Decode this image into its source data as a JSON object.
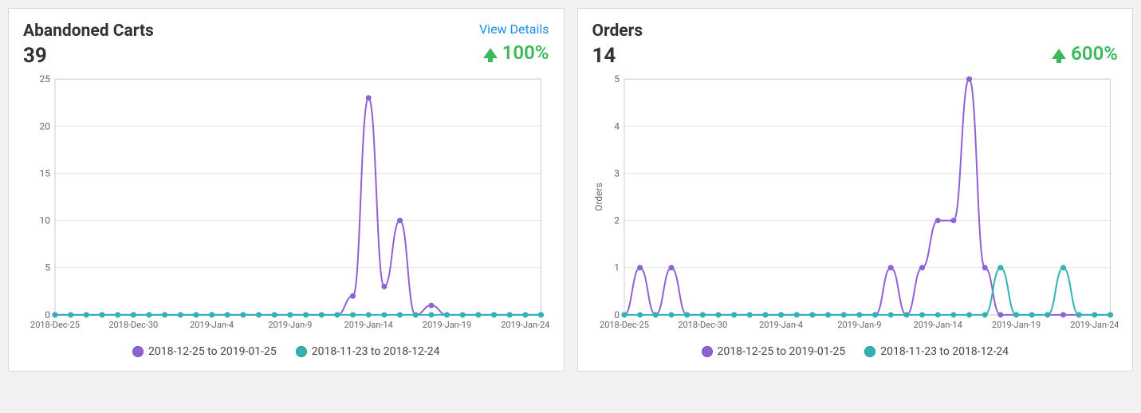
{
  "cards": {
    "abandoned": {
      "title": "Abandoned Carts",
      "value": "39",
      "details_label": "View Details",
      "change": "100%"
    },
    "orders": {
      "title": "Orders",
      "value": "14",
      "change": "600%",
      "yaxis_label": "Orders"
    }
  },
  "legend": {
    "series_a": "2018-12-25 to 2019-01-25",
    "series_b": "2018-11-23 to 2018-12-24"
  },
  "x_ticks": [
    "2018-Dec-25",
    "2018-Dec-30",
    "2019-Jan-4",
    "2019-Jan-9",
    "2019-Jan-14",
    "2019-Jan-19",
    "2019-Jan-24"
  ],
  "colors": {
    "purple": "#8e62d4",
    "teal": "#32b2b2",
    "up": "#3cb95d"
  },
  "chart_data": [
    {
      "type": "line",
      "title": "Abandoned Carts",
      "ylim": [
        0,
        25
      ],
      "yticks": [
        0,
        5,
        10,
        15,
        20,
        25
      ],
      "x": [
        "2018-Dec-25",
        "2018-Dec-26",
        "2018-Dec-27",
        "2018-Dec-28",
        "2018-Dec-29",
        "2018-Dec-30",
        "2018-Dec-31",
        "2019-Jan-1",
        "2019-Jan-2",
        "2019-Jan-3",
        "2019-Jan-4",
        "2019-Jan-5",
        "2019-Jan-6",
        "2019-Jan-7",
        "2019-Jan-8",
        "2019-Jan-9",
        "2019-Jan-10",
        "2019-Jan-11",
        "2019-Jan-12",
        "2019-Jan-13",
        "2019-Jan-14",
        "2019-Jan-15",
        "2019-Jan-16",
        "2019-Jan-17",
        "2019-Jan-18",
        "2019-Jan-19",
        "2019-Jan-20",
        "2019-Jan-21",
        "2019-Jan-22",
        "2019-Jan-23",
        "2019-Jan-24",
        "2019-Jan-25"
      ],
      "series": [
        {
          "name": "2018-12-25 to 2019-01-25",
          "values": [
            0,
            0,
            0,
            0,
            0,
            0,
            0,
            0,
            0,
            0,
            0,
            0,
            0,
            0,
            0,
            0,
            0,
            0,
            0,
            2,
            23,
            3,
            10,
            0,
            1,
            0,
            0,
            0,
            0,
            0,
            0,
            0
          ]
        },
        {
          "name": "2018-11-23 to 2018-12-24",
          "values": [
            0,
            0,
            0,
            0,
            0,
            0,
            0,
            0,
            0,
            0,
            0,
            0,
            0,
            0,
            0,
            0,
            0,
            0,
            0,
            0,
            0,
            0,
            0,
            0,
            0,
            0,
            0,
            0,
            0,
            0,
            0,
            0
          ]
        }
      ]
    },
    {
      "type": "line",
      "title": "Orders",
      "ylabel": "Orders",
      "ylim": [
        0,
        5
      ],
      "yticks": [
        0,
        1,
        2,
        3,
        4,
        5
      ],
      "x": [
        "2018-Dec-25",
        "2018-Dec-26",
        "2018-Dec-27",
        "2018-Dec-28",
        "2018-Dec-29",
        "2018-Dec-30",
        "2018-Dec-31",
        "2019-Jan-1",
        "2019-Jan-2",
        "2019-Jan-3",
        "2019-Jan-4",
        "2019-Jan-5",
        "2019-Jan-6",
        "2019-Jan-7",
        "2019-Jan-8",
        "2019-Jan-9",
        "2019-Jan-10",
        "2019-Jan-11",
        "2019-Jan-12",
        "2019-Jan-13",
        "2019-Jan-14",
        "2019-Jan-15",
        "2019-Jan-16",
        "2019-Jan-17",
        "2019-Jan-18",
        "2019-Jan-19",
        "2019-Jan-20",
        "2019-Jan-21",
        "2019-Jan-22",
        "2019-Jan-23",
        "2019-Jan-24",
        "2019-Jan-25"
      ],
      "series": [
        {
          "name": "2018-12-25 to 2019-01-25",
          "values": [
            0,
            1,
            0,
            1,
            0,
            0,
            0,
            0,
            0,
            0,
            0,
            0,
            0,
            0,
            0,
            0,
            0,
            1,
            0,
            1,
            2,
            2,
            5,
            1,
            0,
            0,
            0,
            0,
            0,
            0,
            0,
            0
          ]
        },
        {
          "name": "2018-11-23 to 2018-12-24",
          "values": [
            0,
            0,
            0,
            0,
            0,
            0,
            0,
            0,
            0,
            0,
            0,
            0,
            0,
            0,
            0,
            0,
            0,
            0,
            0,
            0,
            0,
            0,
            0,
            0,
            1,
            0,
            0,
            0,
            1,
            0,
            0,
            0
          ]
        }
      ]
    }
  ]
}
